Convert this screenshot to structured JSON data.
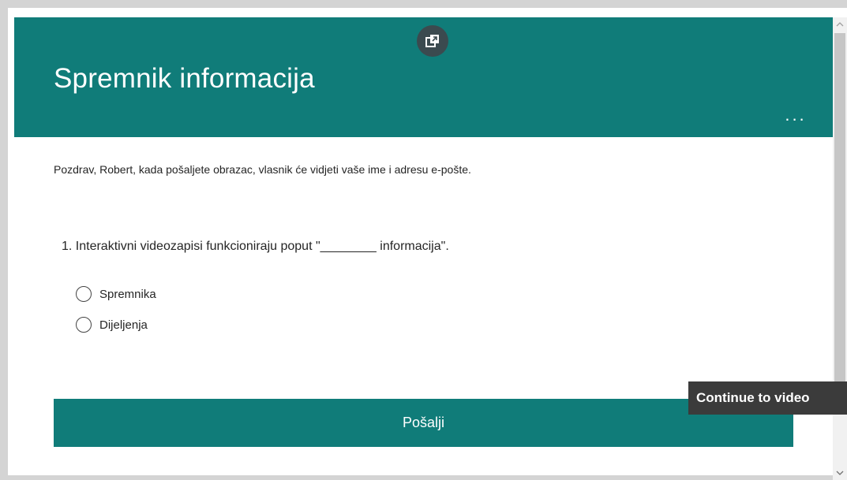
{
  "form": {
    "title": "Spremnik informacija",
    "greeting": "Pozdrav, Robert, kada pošaljete obrazac, vlasnik će vidjeti vaše ime i adresu e-pošte.",
    "more_label": "...",
    "question": {
      "number_and_text": "1. Interaktivni videozapisi funkcioniraju poput \"________ informacija\".",
      "options": [
        {
          "label": "Spremnika",
          "selected": false
        },
        {
          "label": "Dijeljenja",
          "selected": false
        }
      ]
    },
    "submit_label": "Pošalji"
  },
  "tooltip": {
    "text": "Continue to video"
  },
  "icons": {
    "popout": "popout-icon",
    "scroll_up": "chevron-up-icon",
    "scroll_down": "chevron-down-icon"
  },
  "colors": {
    "accent": "#107c79",
    "popout_bg": "#3b4a4f",
    "tooltip_bg": "#3b3b3b"
  }
}
